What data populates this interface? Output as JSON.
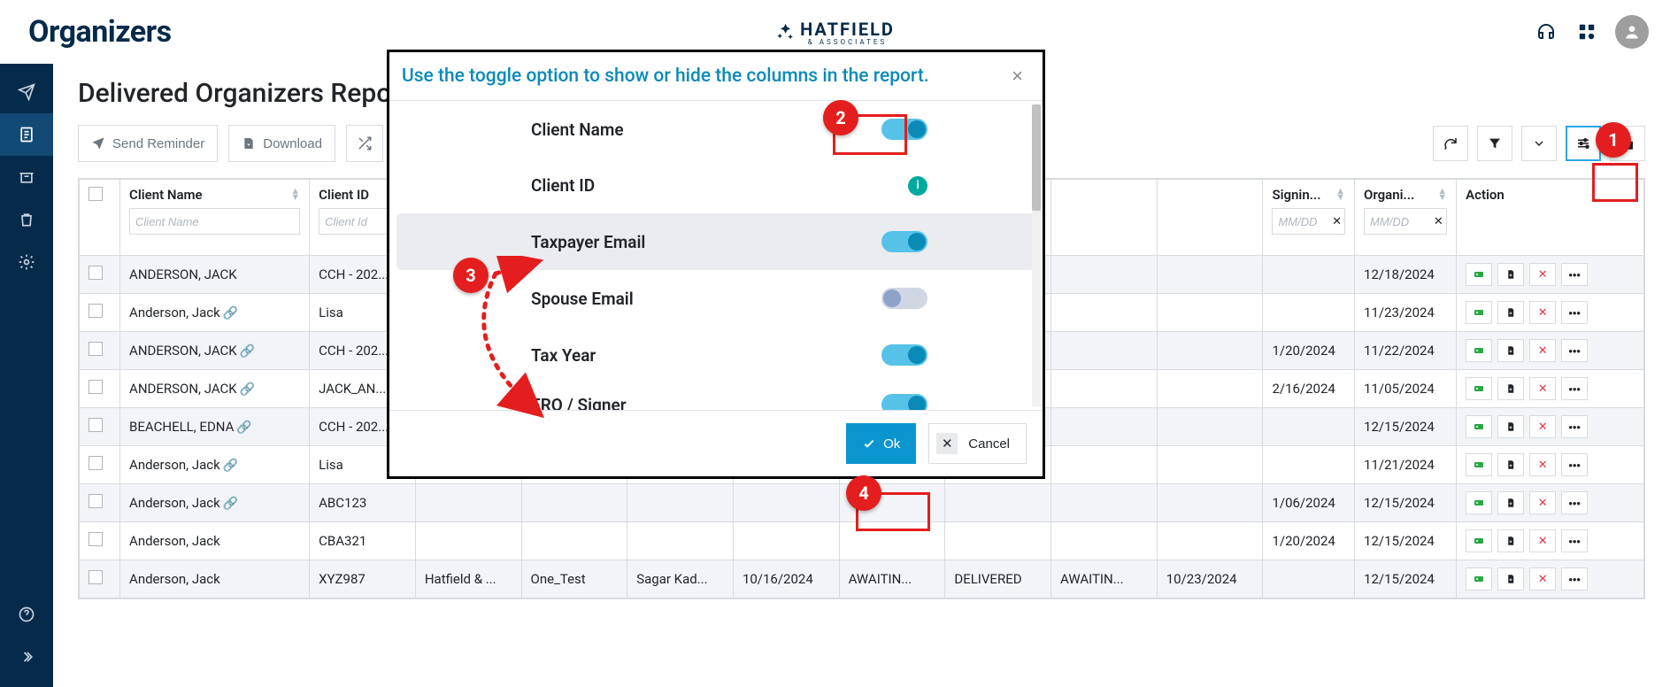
{
  "topbar": {
    "title": "Organizers",
    "brand_name": "HATFIELD",
    "brand_sub": "& ASSOCIATES"
  },
  "page": {
    "title": "Delivered Organizers Report"
  },
  "toolbar": {
    "send_reminder": "Send Reminder",
    "download": "Download"
  },
  "columns": {
    "client_name": {
      "label": "Client Name",
      "placeholder": "Client Name"
    },
    "client_id": {
      "label": "Client ID",
      "placeholder": "Client Id"
    },
    "hidden_a": {
      "label": "",
      "placeholder": ""
    },
    "hidden_b": {
      "label": "",
      "placeholder": ""
    },
    "hidden_c": {
      "label": "",
      "placeholder": ""
    },
    "hidden_d": {
      "label": "",
      "placeholder": ""
    },
    "hidden_e": {
      "label": "",
      "placeholder": ""
    },
    "hidden_f": {
      "label": "",
      "placeholder": ""
    },
    "hidden_g": {
      "label": "",
      "placeholder": ""
    },
    "hidden_h": {
      "label": "",
      "placeholder": ""
    },
    "signing": {
      "label": "Signin...",
      "placeholder": "MM/DD"
    },
    "organizer": {
      "label": "Organi...",
      "placeholder": "MM/DD"
    },
    "action": {
      "label": "Action"
    }
  },
  "rows": [
    {
      "name": "ANDERSON, JACK",
      "link": false,
      "id": "CCH - 202...",
      "a": "",
      "b": "",
      "c": "",
      "d": "",
      "e": "",
      "f": "",
      "g": "",
      "h": "",
      "sign": "",
      "org": "12/18/2024"
    },
    {
      "name": "Anderson, Jack",
      "link": true,
      "id": "Lisa",
      "a": "",
      "b": "",
      "c": "",
      "d": "",
      "e": "",
      "f": "",
      "g": "",
      "h": "",
      "sign": "",
      "org": "11/23/2024"
    },
    {
      "name": "ANDERSON, JACK",
      "link": true,
      "id": "CCH - 202...",
      "a": "",
      "b": "",
      "c": "",
      "d": "",
      "e": "",
      "f": "",
      "g": "",
      "h": "",
      "sign": "1/20/2024",
      "org": "11/22/2024"
    },
    {
      "name": "ANDERSON, JACK",
      "link": true,
      "id": "JACK_AN...",
      "a": "",
      "b": "",
      "c": "",
      "d": "",
      "e": "",
      "f": "",
      "g": "",
      "h": "",
      "sign": "2/16/2024",
      "org": "11/05/2024"
    },
    {
      "name": "BEACHELL, EDNA",
      "link": true,
      "id": "CCH - 202...",
      "a": "",
      "b": "",
      "c": "",
      "d": "",
      "e": "",
      "f": "",
      "g": "",
      "h": "",
      "sign": "",
      "org": "12/15/2024"
    },
    {
      "name": "Anderson, Jack",
      "link": true,
      "id": "Lisa",
      "a": "",
      "b": "",
      "c": "",
      "d": "",
      "e": "",
      "f": "",
      "g": "",
      "h": "",
      "sign": "",
      "org": "11/21/2024"
    },
    {
      "name": "Anderson, Jack",
      "link": true,
      "id": "ABC123",
      "a": "",
      "b": "",
      "c": "",
      "d": "",
      "e": "",
      "f": "",
      "g": "",
      "h": "",
      "sign": "1/06/2024",
      "org": "12/15/2024"
    },
    {
      "name": "Anderson, Jack",
      "link": false,
      "id": "CBA321",
      "a": "",
      "b": "",
      "c": "",
      "d": "",
      "e": "",
      "f": "",
      "g": "",
      "h": "",
      "sign": "1/20/2024",
      "org": "12/15/2024"
    },
    {
      "name": "Anderson, Jack",
      "link": false,
      "id": "XYZ987",
      "a": "Hatfield & ...",
      "b": "One_Test",
      "c": "Sagar Kad...",
      "d": "10/16/2024",
      "e": "AWAITIN...",
      "f": "DELIVERED",
      "g": "AWAITIN...",
      "h": "10/23/2024",
      "sign": "",
      "org": "12/15/2024"
    }
  ],
  "modal": {
    "title": "Use the toggle option to show or hide the columns in the report.",
    "options": [
      {
        "label": "Client Name",
        "state": "on",
        "kind": "toggle"
      },
      {
        "label": "Client ID",
        "state": "info",
        "kind": "info"
      },
      {
        "label": "Taxpayer Email",
        "state": "on",
        "kind": "toggle",
        "highlight": true
      },
      {
        "label": "Spouse Email",
        "state": "off",
        "kind": "toggle"
      },
      {
        "label": "Tax Year",
        "state": "on",
        "kind": "toggle"
      },
      {
        "label": "ERO / Signer",
        "state": "partial",
        "kind": "toggle"
      }
    ],
    "ok": "Ok",
    "cancel": "Cancel"
  },
  "callouts": {
    "1": "1",
    "2": "2",
    "3": "3",
    "4": "4"
  }
}
